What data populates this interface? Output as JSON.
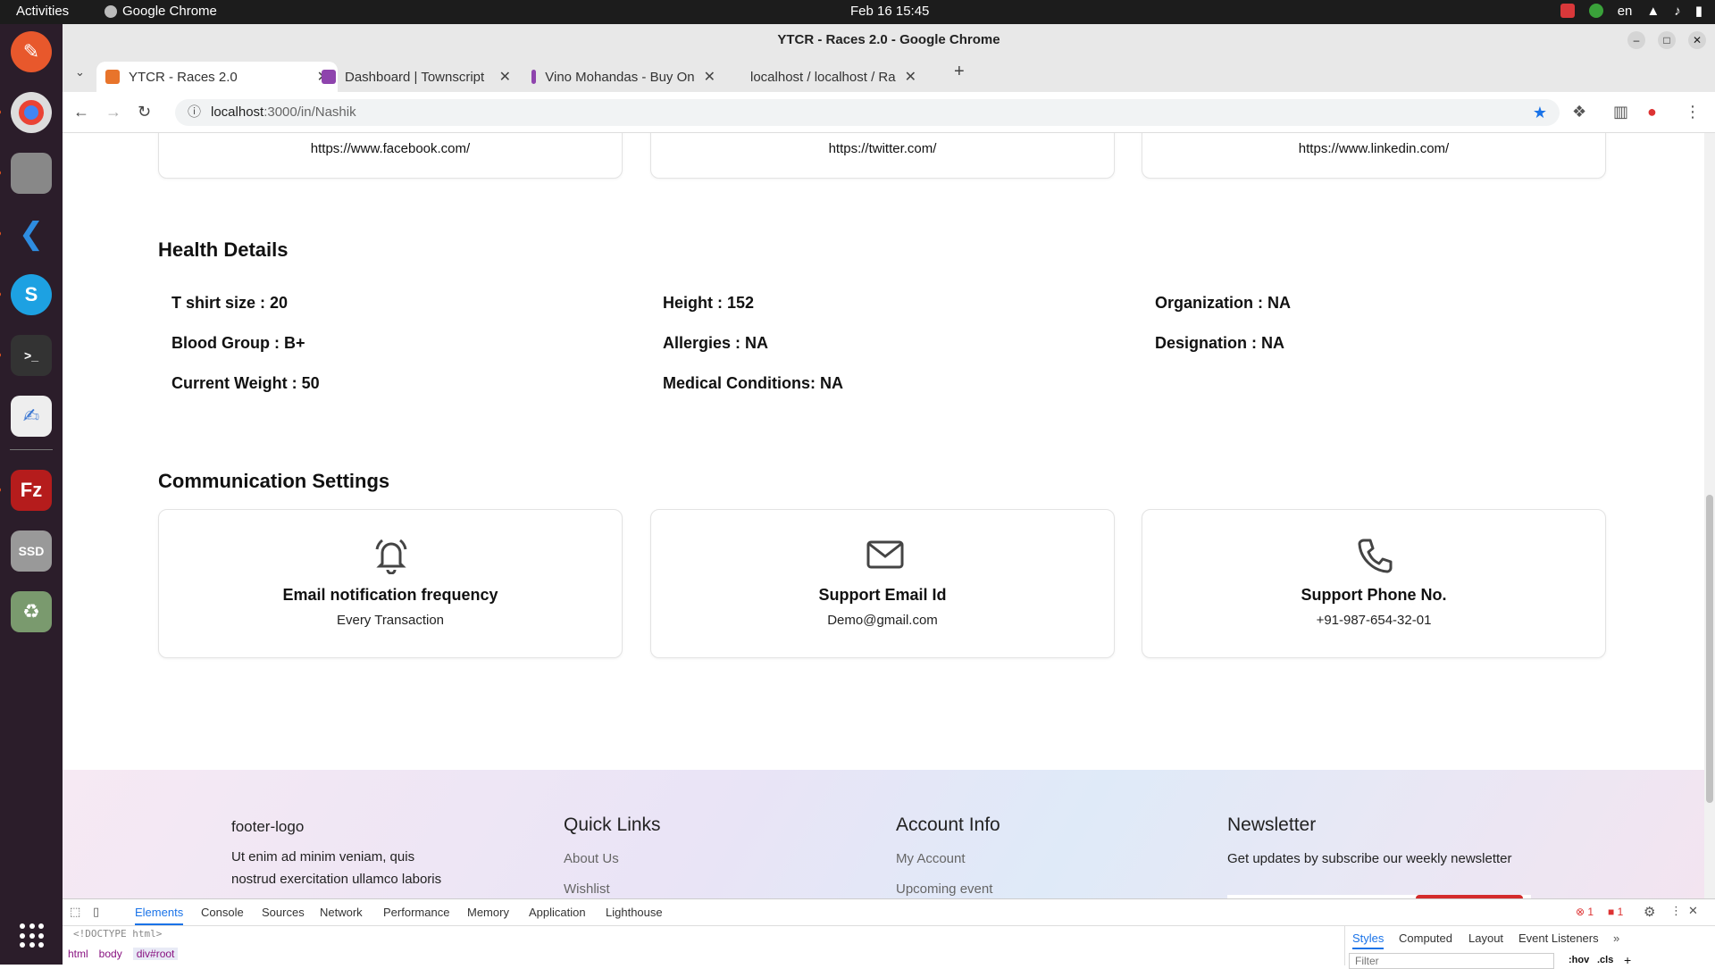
{
  "os": {
    "activities": "Activities",
    "app_name": "Google Chrome",
    "clock": "Feb 16  15:45",
    "lang": "en"
  },
  "browser": {
    "window_title": "YTCR - Races 2.0 - Google Chrome",
    "tabs": [
      {
        "label": "YTCR - Races 2.0",
        "color": "#e8742b"
      },
      {
        "label": "Dashboard | Townscript",
        "color": "#8e44ad"
      },
      {
        "label": "Vino Mohandas - Buy On",
        "color": "#8e44ad"
      },
      {
        "label": "localhost / localhost / Ra",
        "color": "#f0a030"
      }
    ],
    "url_host": "localhost",
    "url_path": ":3000/in/Nashik"
  },
  "social": {
    "facebook": "https://www.facebook.com/",
    "twitter": "https://twitter.com/",
    "linkedin": "https://www.linkedin.com/"
  },
  "health": {
    "title": "Health Details",
    "tshirt": "T shirt size : 20",
    "height": "Height : 152",
    "organization": "Organization : NA",
    "blood_group": "Blood Group : B+",
    "allergies": "Allergies : NA",
    "designation": "Designation : NA",
    "weight": "Current Weight : 50",
    "medical": "Medical Conditions: NA"
  },
  "communication": {
    "title": "Communication Settings",
    "cards": [
      {
        "title": "Email notification frequency",
        "value": "Every Transaction",
        "icon": "bell-icon"
      },
      {
        "title": "Support Email Id",
        "value": "Demo@gmail.com",
        "icon": "mail-icon"
      },
      {
        "title": "Support Phone No.",
        "value": "+91-987-654-32-01",
        "icon": "phone-icon"
      }
    ]
  },
  "footer": {
    "logo_alt": "footer-logo",
    "about_text_1": "Ut enim ad minim veniam, quis",
    "about_text_2": "nostrud exercitation ullamco laboris",
    "quick_links_title": "Quick Links",
    "quick_links": [
      "About Us",
      "Wishlist"
    ],
    "account_title": "Account Info",
    "account_links": [
      "My Account",
      "Upcoming event"
    ],
    "newsletter_title": "Newsletter",
    "newsletter_text": "Get updates by subscribe our weekly newsletter"
  },
  "devtools": {
    "tabs": [
      "Elements",
      "Console",
      "Sources",
      "Network",
      "Performance",
      "Memory",
      "Application",
      "Lighthouse"
    ],
    "doctype": "<!DOCTYPE html>",
    "crumbs": [
      "html",
      "body",
      "div#root"
    ],
    "side_tabs": [
      "Styles",
      "Computed",
      "Layout",
      "Event Listeners"
    ],
    "filter_placeholder": "Filter",
    "errors": "1",
    "issues": "1",
    "hov": ":hov",
    "cls": ".cls"
  }
}
